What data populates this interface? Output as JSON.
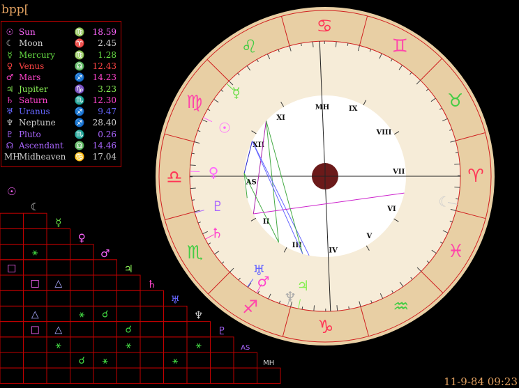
{
  "header": {
    "title": "bpp["
  },
  "planets": [
    {
      "glyph": "☉",
      "name": "Sun",
      "sign": "♍",
      "degree": "18.59",
      "color": "#ff66ff"
    },
    {
      "glyph": "☾",
      "name": "Moon",
      "sign": "♈",
      "degree": "2.45",
      "color": "#d0d0d0"
    },
    {
      "glyph": "☿",
      "name": "Mercury",
      "sign": "♍",
      "degree": "1.28",
      "color": "#66dd44"
    },
    {
      "glyph": "♀",
      "name": "Venus",
      "sign": "♎",
      "degree": "12.43",
      "color": "#ff4444"
    },
    {
      "glyph": "♂",
      "name": "Mars",
      "sign": "♐",
      "degree": "14.23",
      "color": "#ff44cc"
    },
    {
      "glyph": "♃",
      "name": "Jupiter",
      "sign": "♑",
      "degree": "3.23",
      "color": "#88ee55"
    },
    {
      "glyph": "♄",
      "name": "Saturn",
      "sign": "♏",
      "degree": "12.30",
      "color": "#ff44cc"
    },
    {
      "glyph": "♅",
      "name": "Uranus",
      "sign": "♐",
      "degree": "9.47",
      "color": "#6666ff"
    },
    {
      "glyph": "♆",
      "name": "Neptune",
      "sign": "♐",
      "degree": "28.40",
      "color": "#d0d0d0"
    },
    {
      "glyph": "♇",
      "name": "Pluto",
      "sign": "♏",
      "degree": "0.26",
      "color": "#aa66ff"
    },
    {
      "glyph": "☊",
      "name": "Ascendant",
      "sign": "♎",
      "degree": "14.46",
      "color": "#aa66ff"
    },
    {
      "glyph": "MH",
      "name": "Midheaven",
      "sign": "♋",
      "degree": "17.04",
      "color": "#d0d0d0"
    }
  ],
  "houses": [
    "MH",
    "XI",
    "XII",
    "AS",
    "II",
    "III",
    "IV",
    "V",
    "VI",
    "VII",
    "VIII",
    "IX"
  ],
  "zodiac": [
    "♈",
    "♉",
    "♊",
    "♋",
    "♌",
    "♍",
    "♎",
    "♏",
    "♐",
    "♑",
    "♒",
    "♓"
  ],
  "aspect_grid": {
    "row_labels": [
      "☉",
      "☾",
      "☿",
      "♀",
      "♂",
      "♃",
      "♄",
      "♅",
      "♆",
      "♇",
      "AS",
      "MH"
    ],
    "label_colors": [
      "#ff66ff",
      "#d0d0d0",
      "#66dd44",
      "#ff66ff",
      "#ff66ff",
      "#88ee55",
      "#ff44cc",
      "#6666ff",
      "#d0d0d0",
      "#aa66ff",
      "#aa66ff",
      "#d0d0d0"
    ],
    "cells": [
      {
        "r": 4,
        "c": 0,
        "s": "□",
        "col": "#ff66ff"
      },
      {
        "r": 3,
        "c": 1,
        "s": "⚹",
        "col": "#44dd44"
      },
      {
        "r": 5,
        "c": 1,
        "s": "□",
        "col": "#ff66ff"
      },
      {
        "r": 5,
        "c": 2,
        "s": "△",
        "col": "#aaaaff"
      },
      {
        "r": 7,
        "c": 1,
        "s": "△",
        "col": "#aaaaff"
      },
      {
        "r": 7,
        "c": 3,
        "s": "⚹",
        "col": "#44dd44"
      },
      {
        "r": 7,
        "c": 4,
        "s": "☌",
        "col": "#44dd44"
      },
      {
        "r": 8,
        "c": 1,
        "s": "□",
        "col": "#ff66ff"
      },
      {
        "r": 8,
        "c": 2,
        "s": "△",
        "col": "#aaaaff"
      },
      {
        "r": 8,
        "c": 5,
        "s": "☌",
        "col": "#44dd44"
      },
      {
        "r": 9,
        "c": 2,
        "s": "⚹",
        "col": "#44dd44"
      },
      {
        "r": 9,
        "c": 5,
        "s": "⚹",
        "col": "#44dd44"
      },
      {
        "r": 9,
        "c": 8,
        "s": "⚹",
        "col": "#44dd44"
      },
      {
        "r": 10,
        "c": 3,
        "s": "☌",
        "col": "#44dd44"
      },
      {
        "r": 10,
        "c": 4,
        "s": "⚹",
        "col": "#44dd44"
      },
      {
        "r": 10,
        "c": 7,
        "s": "⚹",
        "col": "#44dd44"
      }
    ]
  },
  "footer": {
    "datetime": "11-9-84 09:23"
  },
  "colors": {
    "wheel_band": "#e8cfa4",
    "wheel_inner": "#f6ecd8",
    "wheel_center": "#ffffff",
    "grid_line": "#c00000",
    "title": "#e0a060"
  }
}
